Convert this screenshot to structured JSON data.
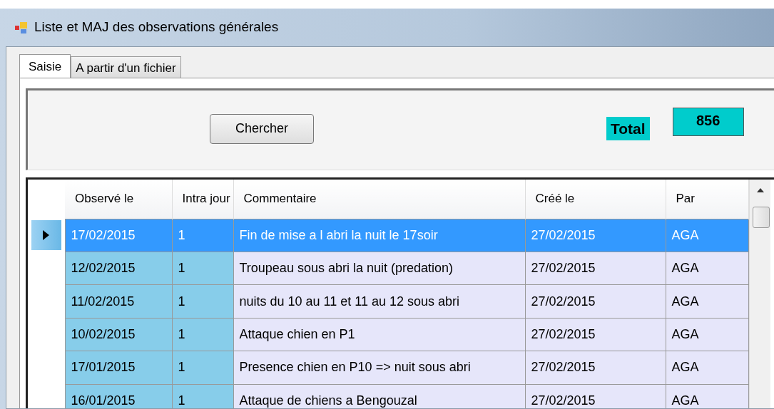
{
  "window": {
    "title": "Liste et MAJ des observations générales"
  },
  "tabs": [
    {
      "label": "Saisie",
      "selected": true
    },
    {
      "label": "A partir d'un fichier",
      "selected": false
    }
  ],
  "search_button": "Chercher",
  "total": {
    "label": "Total",
    "value": "856"
  },
  "table": {
    "columns": [
      "Observé le",
      "Intra jour",
      "Commentaire",
      "Créé le",
      "Par"
    ],
    "rows": [
      {
        "selected": true,
        "cells": [
          "17/02/2015",
          "1",
          "Fin de mise a l abri la nuit le 17soir",
          "27/02/2015",
          "AGA"
        ]
      },
      {
        "selected": false,
        "cells": [
          "12/02/2015",
          "1",
          "Troupeau sous abri la nuit (predation)",
          "27/02/2015",
          "AGA"
        ]
      },
      {
        "selected": false,
        "cells": [
          "11/02/2015",
          "1",
          "nuits du 10 au 11 et 11 au 12 sous abri",
          "27/02/2015",
          "AGA"
        ]
      },
      {
        "selected": false,
        "cells": [
          "10/02/2015",
          "1",
          "Attaque chien en P1",
          "27/02/2015",
          "AGA"
        ]
      },
      {
        "selected": false,
        "cells": [
          "17/01/2015",
          "1",
          "Presence chien en P10 => nuit sous abri",
          "27/02/2015",
          "AGA"
        ]
      },
      {
        "selected": false,
        "cells": [
          "16/01/2015",
          "1",
          "Attaque de chiens a Bengouzal",
          "27/02/2015",
          "AGA"
        ]
      }
    ]
  }
}
